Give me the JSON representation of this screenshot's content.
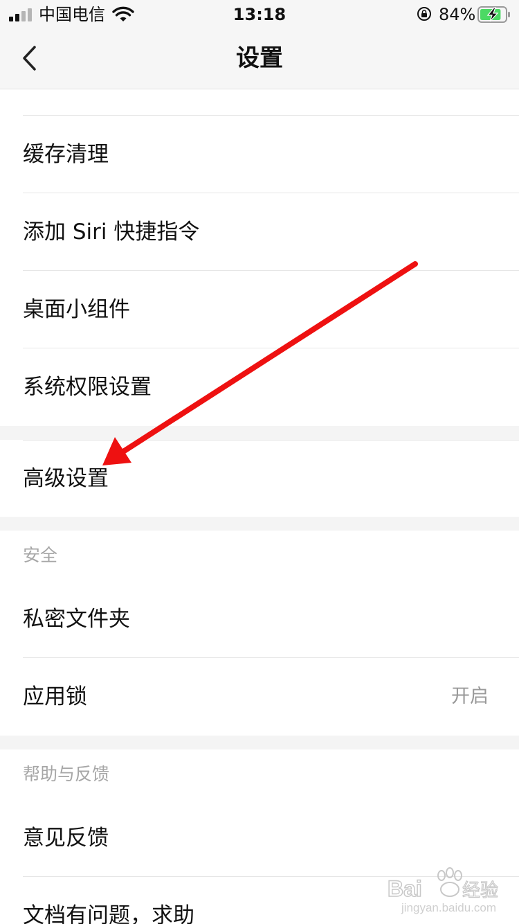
{
  "status_bar": {
    "carrier": "中国电信",
    "time": "13:18",
    "battery_percent": "84%",
    "battery_level": 0.84
  },
  "nav": {
    "title": "设置",
    "back_icon": "chevron-left-icon"
  },
  "groups": [
    {
      "items": [
        {
          "label": "缓存清理"
        },
        {
          "label": "添加 Siri 快捷指令"
        },
        {
          "label": "桌面小组件"
        },
        {
          "label": "系统权限设置"
        }
      ]
    },
    {
      "items": [
        {
          "label": "高级设置"
        }
      ]
    },
    {
      "header": "安全",
      "items": [
        {
          "label": "私密文件夹"
        },
        {
          "label": "应用锁",
          "value": "开启"
        }
      ]
    },
    {
      "header": "帮助与反馈",
      "items": [
        {
          "label": "意见反馈"
        },
        {
          "label": "文档有问题，求助"
        }
      ]
    }
  ],
  "annotation": {
    "type": "arrow",
    "color": "#ee1111",
    "target": "高级设置"
  },
  "watermark": {
    "text": "Baidu经验",
    "subtext": "jingyan.baidu.com"
  }
}
